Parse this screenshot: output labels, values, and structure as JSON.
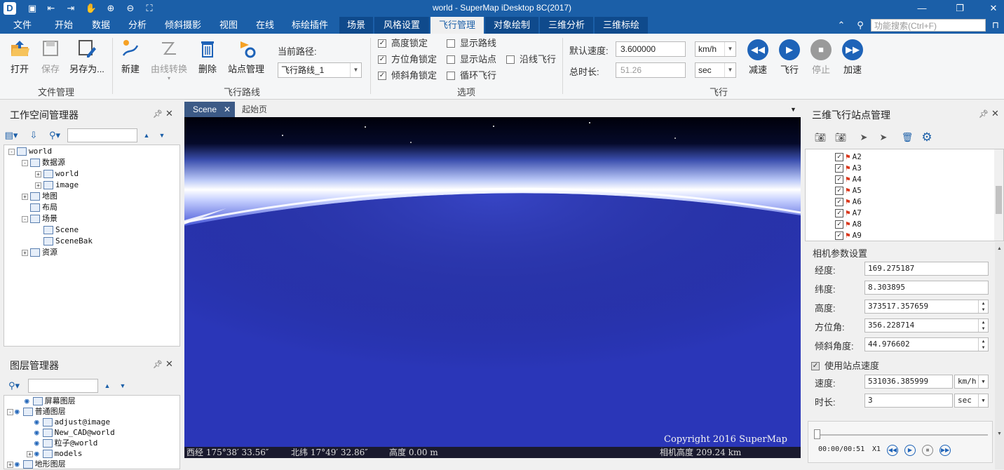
{
  "window": {
    "title": "world - SuperMap iDesktop 8C(2017)",
    "minimize": "—",
    "maximize": "❐",
    "close": "✕"
  },
  "menu": {
    "items": [
      "文件",
      "开始",
      "数据",
      "分析",
      "倾斜摄影",
      "视图",
      "在线",
      "标绘插件",
      "场景",
      "风格设置",
      "飞行管理",
      "对象绘制",
      "三维分析",
      "三维标绘"
    ],
    "search_placeholder": "功能搜索(Ctrl+F)"
  },
  "ribbon": {
    "file": {
      "open": "打开",
      "save": "保存",
      "save_as": "另存为...",
      "group": "文件管理"
    },
    "route": {
      "new": "新建",
      "convert": "由线转换",
      "delete": "删除",
      "station": "站点管理",
      "current_label": "当前路径:",
      "current_value": "飞行路线_1",
      "group": "飞行路线"
    },
    "options": {
      "height_lock": "高度锁定",
      "azimuth_lock": "方位角锁定",
      "tilt_lock": "倾斜角锁定",
      "show_route": "显示路线",
      "show_station": "显示站点",
      "loop": "循环飞行",
      "along_line": "沿线飞行",
      "group": "选项",
      "checked": {
        "height_lock": true,
        "azimuth_lock": true,
        "tilt_lock": true,
        "show_route": false,
        "show_station": false,
        "loop": false,
        "along_line": false
      }
    },
    "fly": {
      "speed_label": "默认速度:",
      "speed_value": "3.600000",
      "speed_unit": "km/h",
      "duration_label": "总时长:",
      "duration_value": "51.26",
      "duration_unit": "sec",
      "slow": "减速",
      "fly": "飞行",
      "stop": "停止",
      "fast": "加速",
      "group": "飞行"
    }
  },
  "workspace": {
    "title": "工作空间管理器",
    "tree": [
      {
        "label": "world",
        "level": 0,
        "exp": "-"
      },
      {
        "label": "数据源",
        "level": 1,
        "exp": "-"
      },
      {
        "label": "world",
        "level": 2,
        "exp": "+"
      },
      {
        "label": "image",
        "level": 2,
        "exp": "+"
      },
      {
        "label": "地图",
        "level": 1,
        "exp": "+"
      },
      {
        "label": "布局",
        "level": 1,
        "exp": ""
      },
      {
        "label": "场景",
        "level": 1,
        "exp": "-"
      },
      {
        "label": "Scene",
        "level": 2,
        "exp": ""
      },
      {
        "label": "SceneBak",
        "level": 2,
        "exp": ""
      },
      {
        "label": "资源",
        "level": 1,
        "exp": "+"
      }
    ]
  },
  "layers": {
    "title": "图层管理器",
    "tree": [
      {
        "label": "屏幕图层",
        "level": 1,
        "exp": ""
      },
      {
        "label": "普通图层",
        "level": 0,
        "exp": "-"
      },
      {
        "label": "adjust@image",
        "level": 2,
        "exp": ""
      },
      {
        "label": "New_CAD@world",
        "level": 2,
        "exp": ""
      },
      {
        "label": "粒子@world",
        "level": 2,
        "exp": ""
      },
      {
        "label": "models",
        "level": 2,
        "exp": "+"
      },
      {
        "label": "地形图层",
        "level": 0,
        "exp": "+"
      }
    ]
  },
  "tabs": {
    "scene": "Scene",
    "start": "起始页"
  },
  "scene": {
    "status_lon": "西经 175°38′ 33.56″",
    "status_lat": "北纬 17°49′ 32.86″",
    "status_alt": "高度 0.00 m",
    "status_cam": "相机高度 209.24 km",
    "copyright": "Copyright 2016 SuperMap"
  },
  "stations": {
    "title": "三维飞行站点管理",
    "items": [
      "A2",
      "A3",
      "A4",
      "A5",
      "A6",
      "A7",
      "A8",
      "A9"
    ],
    "camera_title": "相机参数设置",
    "longitude_label": "经度:",
    "longitude": "169.275187",
    "latitude_label": "纬度:",
    "latitude": "8.303895",
    "height_label": "高度:",
    "height": "373517.357659",
    "azimuth_label": "方位角:",
    "azimuth": "356.228714",
    "tilt_label": "倾斜角度:",
    "tilt": "44.976602",
    "use_speed_label": "使用站点速度",
    "speed_label": "速度:",
    "speed": "531036.385999",
    "speed_unit": "km/h",
    "duration_label": "时长:",
    "duration": "3",
    "duration_unit": "sec",
    "time": "00:00/00:51",
    "rate": "X1"
  },
  "colors": {
    "titlebar": "#1b5fa8",
    "accent": "#1e63b8",
    "active_tab": "#f0f0f0"
  }
}
